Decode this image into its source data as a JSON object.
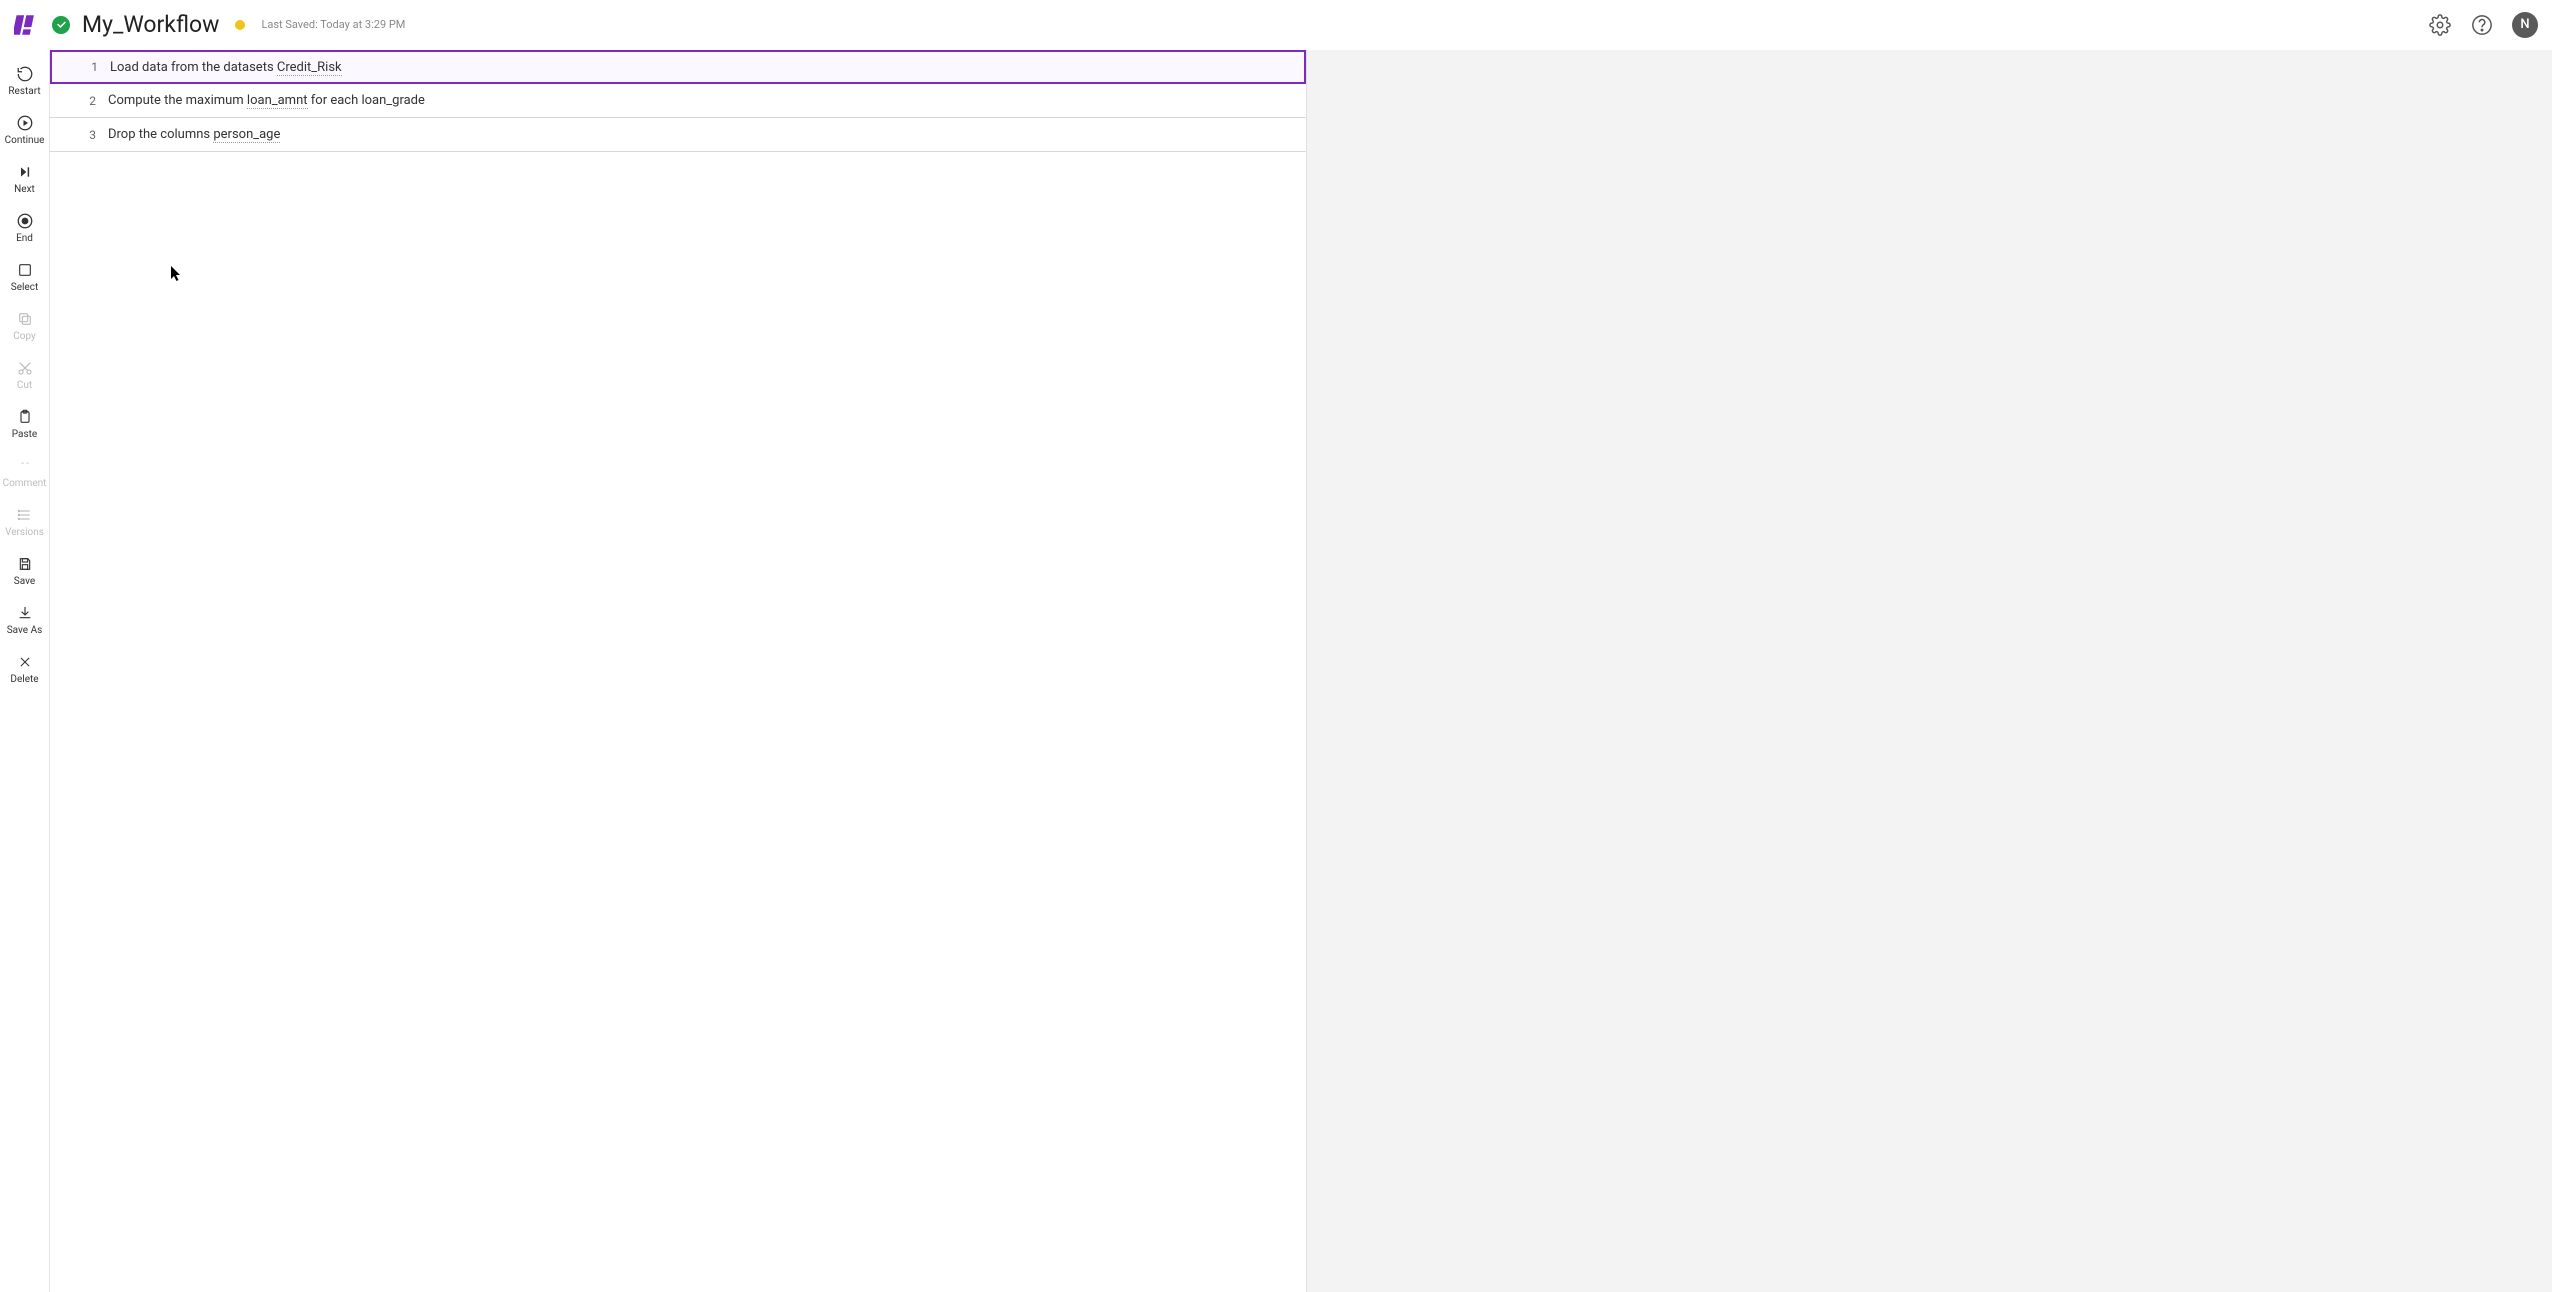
{
  "header": {
    "title": "My_Workflow",
    "last_saved": "Last Saved: Today at 3:29 PM",
    "avatar_initial": "N"
  },
  "rail": {
    "restart": "Restart",
    "continue": "Continue",
    "next": "Next",
    "end": "End",
    "select": "Select",
    "copy": "Copy",
    "cut": "Cut",
    "paste": "Paste",
    "comment": "Comment",
    "versions": "Versions",
    "save": "Save",
    "save_as": "Save As",
    "delete": "Delete"
  },
  "steps": [
    {
      "num": "1",
      "text_a": "Load data from the datasets ",
      "text_u": "Credit_Risk",
      "text_b": ""
    },
    {
      "num": "2",
      "text_a": "Compute the maximum ",
      "text_u": "loan_amnt",
      "text_b": " for each loan_grade"
    },
    {
      "num": "3",
      "text_a": "Drop the columns ",
      "text_u": "person_age",
      "text_b": ""
    }
  ]
}
